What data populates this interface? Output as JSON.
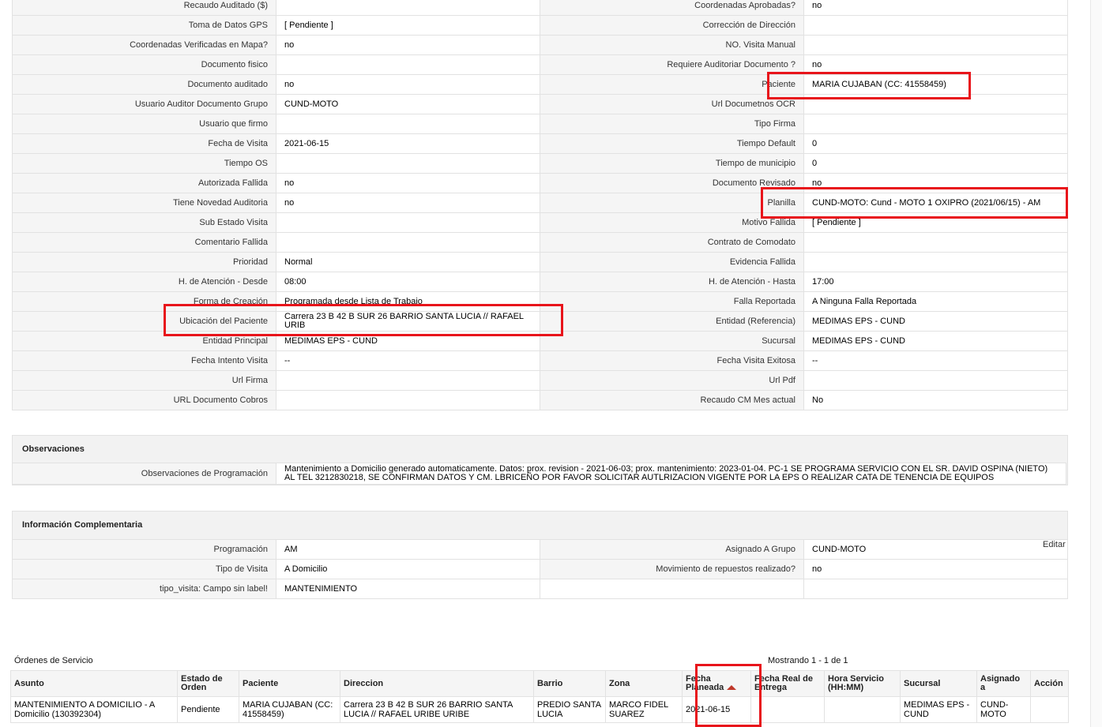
{
  "detail": {
    "rows": [
      {
        "l1": "Recaudo Auditado ($)",
        "v1": "",
        "l2": "Coordenadas Aprobadas?",
        "v2": "no"
      },
      {
        "l1": "Toma de Datos GPS",
        "v1": "[ Pendiente ]",
        "l2": "Corrección de Dirección",
        "v2": ""
      },
      {
        "l1": "Coordenadas Verificadas en Mapa?",
        "v1": "no",
        "l2": "NO. Visita Manual",
        "v2": ""
      },
      {
        "l1": "Documento fisico",
        "v1": "",
        "l2": "Requiere Auditoriar Documento ?",
        "v2": "no"
      },
      {
        "l1": "Documento auditado",
        "v1": "no",
        "l2": "Paciente",
        "v2": "MARIA CUJABAN (CC: 41558459)"
      },
      {
        "l1": "Usuario Auditor Documento Grupo",
        "v1": "CUND-MOTO",
        "l2": "Url Documetnos OCR",
        "v2": ""
      },
      {
        "l1": "Usuario que firmo",
        "v1": "",
        "l2": "Tipo Firma",
        "v2": ""
      },
      {
        "l1": "Fecha de Visita",
        "v1": "2021-06-15",
        "l2": "Tiempo Default",
        "v2": "0"
      },
      {
        "l1": "Tiempo OS",
        "v1": "",
        "l2": "Tiempo de municipio",
        "v2": "0"
      },
      {
        "l1": "Autorizada Fallida",
        "v1": "no",
        "l2": "Documento Revisado",
        "v2": "no"
      },
      {
        "l1": "Tiene Novedad Auditoria",
        "v1": "no",
        "l2": "Planilla",
        "v2": "CUND-MOTO: Cund - MOTO 1 OXIPRO (2021/06/15) - AM"
      },
      {
        "l1": "Sub Estado Visita",
        "v1": "",
        "l2": "Motivo Fallida",
        "v2": "[ Pendiente ]"
      },
      {
        "l1": "Comentario Fallida",
        "v1": "",
        "l2": "Contrato de Comodato",
        "v2": ""
      },
      {
        "l1": "Prioridad",
        "v1": "Normal",
        "l2": "Evidencia Fallida",
        "v2": ""
      },
      {
        "l1": "H. de Atención - Desde",
        "v1": "08:00",
        "l2": "H. de Atención - Hasta",
        "v2": "17:00"
      },
      {
        "l1": "Forma de Creación",
        "v1": "Programada desde Lista de Trabajo",
        "l2": "Falla Reportada",
        "v2": "A Ninguna Falla Reportada"
      },
      {
        "l1": "Ubicación del Paciente",
        "v1": "Carrera 23 B 42 B SUR 26 BARRIO SANTA LUCIA // RAFAEL URIB",
        "l2": "Entidad (Referencia)",
        "v2": "MEDIMAS EPS - CUND"
      },
      {
        "l1": "Entidad Principal",
        "v1": "MEDIMAS EPS - CUND",
        "l2": "Sucursal",
        "v2": "MEDIMAS EPS - CUND"
      },
      {
        "l1": "Fecha Intento Visita",
        "v1": "--",
        "l2": "Fecha Visita Exitosa",
        "v2": "--"
      },
      {
        "l1": "Url Firma",
        "v1": "",
        "l2": "Url Pdf",
        "v2": ""
      },
      {
        "l1": "URL Documento Cobros",
        "v1": "",
        "l2": "Recaudo CM Mes actual",
        "v2": "No"
      }
    ]
  },
  "observaciones": {
    "title": "Observaciones",
    "label": "Observaciones de Programación",
    "value": "Mantenimiento a Domicilio generado automaticamente. Datos: prox. revision - 2021-06-03; prox. mantenimiento: 2023-01-04. PC-1 SE PROGRAMA SERVICIO CON EL SR. DAVID OSPINA (NIETO) AL TEL 3212830218, SE CONFIRMAN DATOS Y CM. LBRICEÑO POR FAVOR SOLICITAR AUTLRIZACION VIGENTE POR LA EPS O REALIZAR CATA DE TENENCIA DE EQUIPOS"
  },
  "complementaria": {
    "title": "Información Complementaria",
    "edit_label": "Editar",
    "rows": [
      {
        "l1": "Programación",
        "v1": "AM",
        "l2": "Asignado A Grupo",
        "v2": "CUND-MOTO"
      },
      {
        "l1": "Tipo de Visita",
        "v1": "A Domicilio",
        "l2": "Movimiento de repuestos realizado?",
        "v2": "no"
      },
      {
        "l1": "tipo_visita: Campo sin label!",
        "v1": "MANTENIMIENTO"
      }
    ]
  },
  "ordenes": {
    "title": "Órdenes de Servicio",
    "count": "Mostrando 1 - 1 de 1",
    "headers": [
      "Asunto",
      "Estado de Orden",
      "Paciente",
      "Direccion",
      "Barrio",
      "Zona",
      "Fecha Planeada",
      "Fecha Real de Entrega",
      "Hora Servicio (HH:MM)",
      "Sucursal",
      "Asignado a",
      "Acción"
    ],
    "rows": [
      [
        "MANTENIMIENTO A DOMICILIO - A Domicilio (130392304)",
        "Pendiente",
        "MARIA CUJABAN (CC: 41558459)",
        "Carrera 23 B 42 B SUR 26 BARRIO SANTA LUCIA // RAFAEL URIBE URIBE",
        "PREDIO SANTA LUCIA",
        "MARCO FIDEL SUAREZ",
        "2021-06-15",
        "",
        "",
        "MEDIMAS EPS - CUND",
        "CUND-MOTO",
        ""
      ]
    ]
  },
  "colors": {
    "highlight": "#e8141b",
    "label_bg": "#f5f5f5",
    "border": "#e2e2e2",
    "sort_arrow": "#c0392b"
  },
  "icons": {
    "sort": "sort-ascending-icon"
  }
}
